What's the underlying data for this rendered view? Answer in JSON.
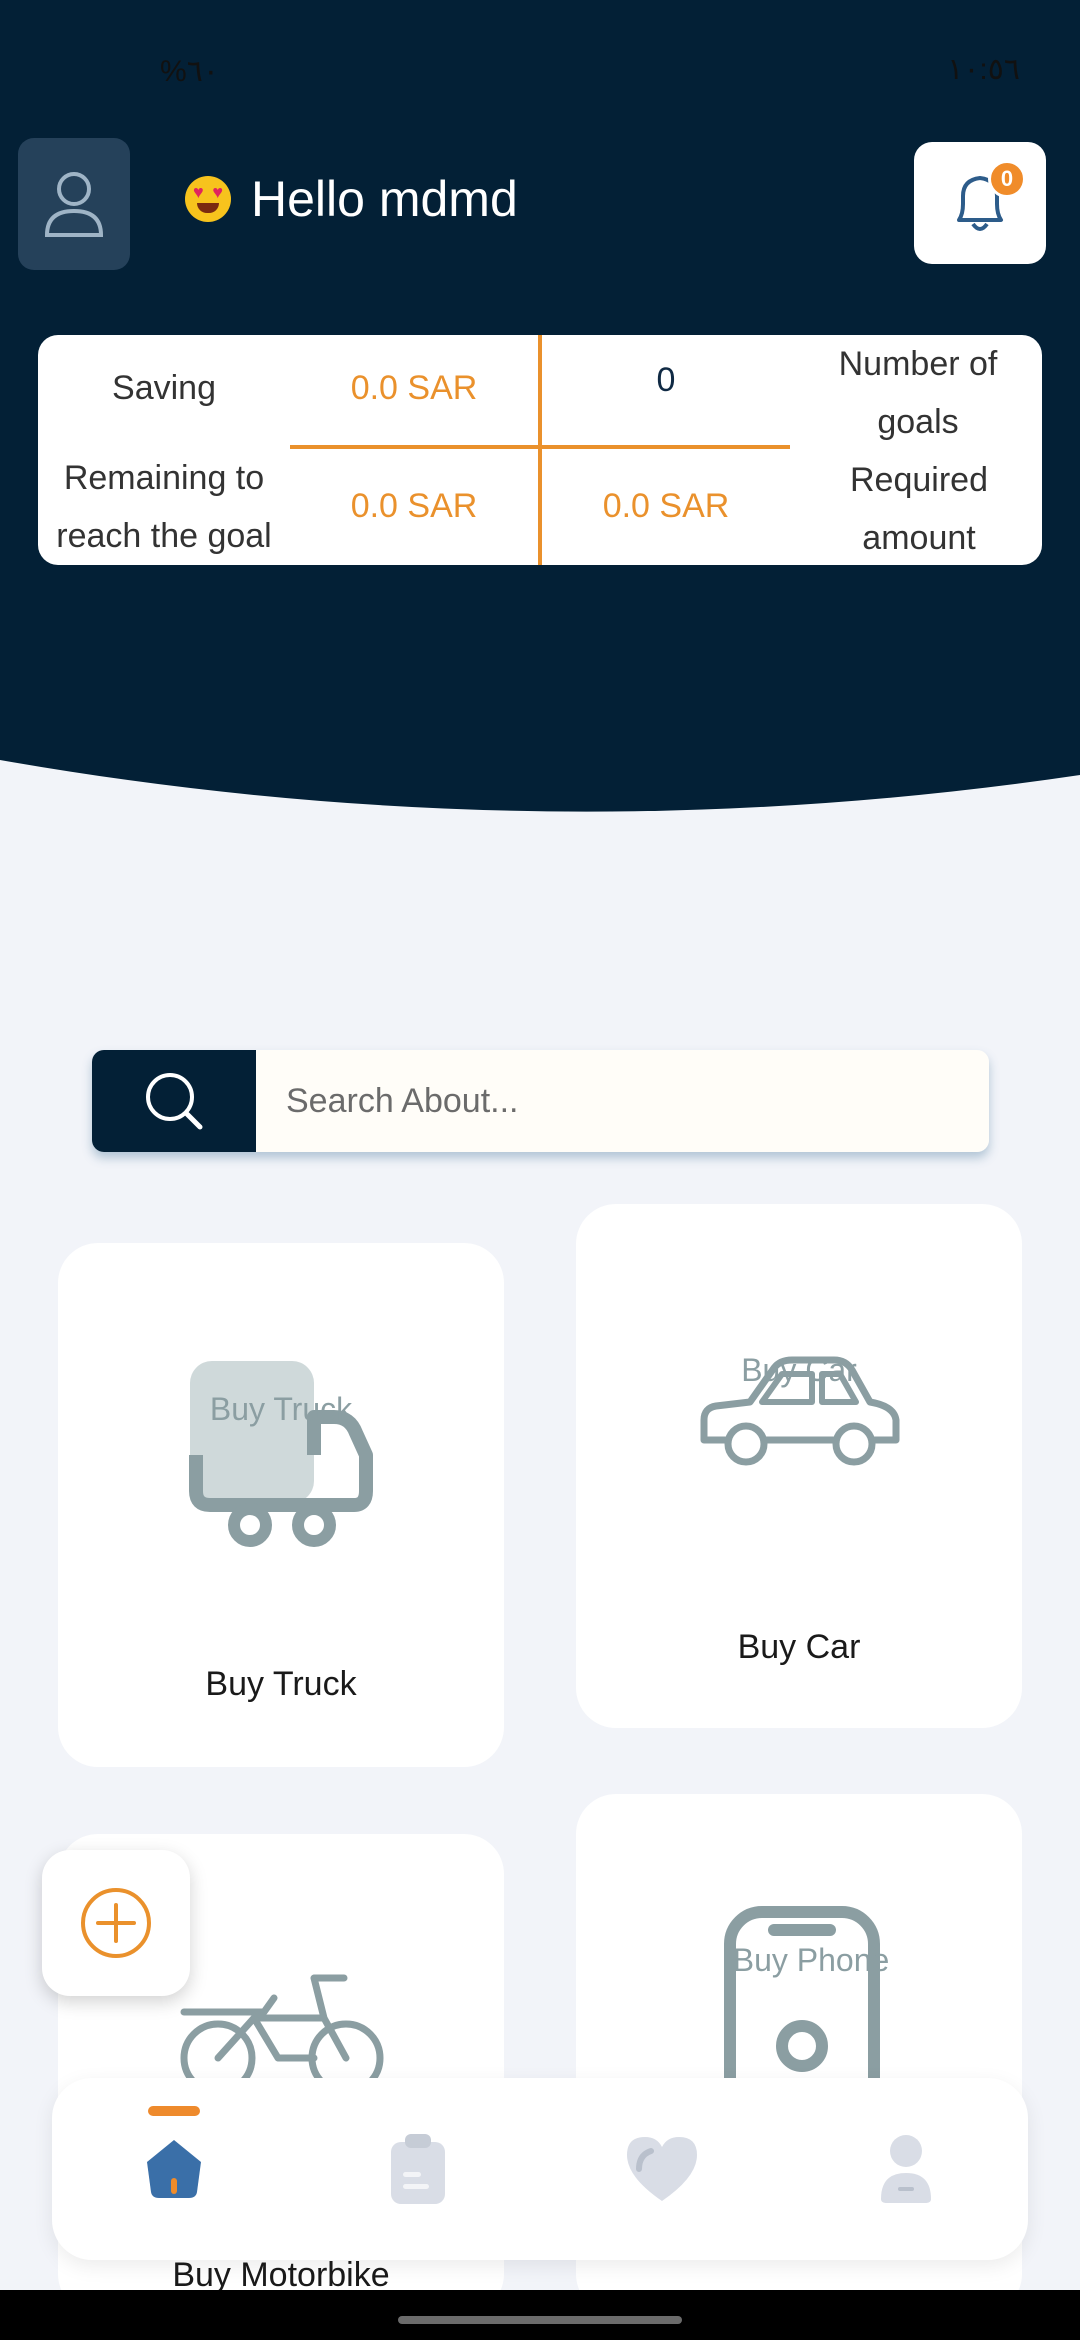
{
  "status_bar": {
    "left": "%٦٠",
    "right": "١٠:٥٦"
  },
  "header": {
    "greeting": "Hello mdmd",
    "notification_count": "0"
  },
  "summary": {
    "saving_label": "Saving",
    "saving_value": "0.0 SAR",
    "goals_count": "0",
    "goals_label": "Number of goals",
    "remaining_label": "Remaining to reach the goal",
    "remaining_value": "0.0 SAR",
    "required_value": "0.0 SAR",
    "required_label": "Required amount"
  },
  "search": {
    "placeholder": "Search About..."
  },
  "cards": [
    {
      "title": "Buy Truck",
      "overlay": "Buy Truck",
      "icon": "truck-icon"
    },
    {
      "title": "Buy Car",
      "overlay": "Buy Car",
      "icon": "car-icon"
    },
    {
      "title": "Buy Motorbike",
      "overlay": "",
      "icon": "motorbike-icon"
    },
    {
      "title": "",
      "overlay": "Buy Phone",
      "icon": "phone-icon"
    }
  ],
  "bottom_nav": {
    "items": [
      "home-icon",
      "clipboard-icon",
      "heart-icon",
      "profile-icon"
    ],
    "active": 0
  },
  "colors": {
    "navy": "#032036",
    "accent": "#ea912c",
    "icon_gray": "#8b9ea2"
  }
}
